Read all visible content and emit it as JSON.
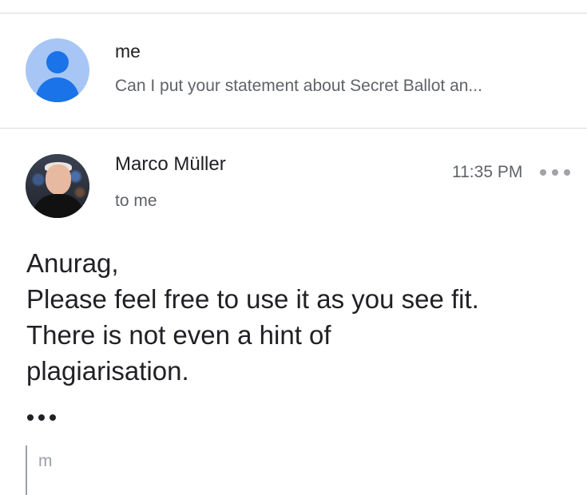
{
  "thread": {
    "collapsed_message": {
      "sender": "me",
      "snippet": "Can I put your statement about Secret Ballot an..."
    },
    "expanded_message": {
      "sender": "Marco Müller",
      "recipient": "to me",
      "time": "11:35 PM",
      "more_icon": "more-horizontal-icon",
      "body_lines": [
        "Anurag,",
        "Please feel free to use it as you see fit.",
        "There is not even a hint of",
        "plagiarisation."
      ],
      "trimmed_icon": "ellipsis-icon",
      "quoted_text": "m"
    }
  },
  "colors": {
    "primary_text": "#202124",
    "secondary_text": "#5f6368",
    "avatar_blue": "#1a73e8",
    "avatar_light_blue": "#a7c6f5",
    "divider": "#dadce0"
  }
}
